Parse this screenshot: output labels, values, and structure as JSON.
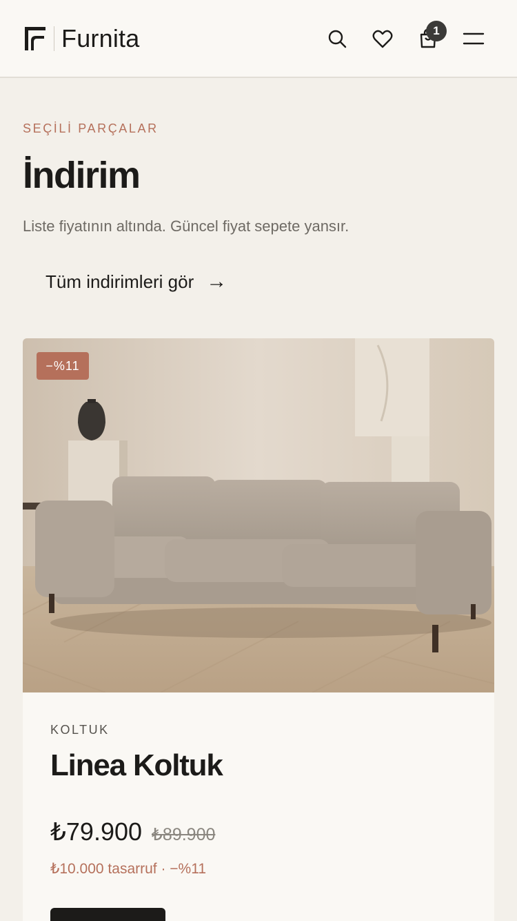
{
  "header": {
    "brand": "Furnita",
    "cart_count": "1",
    "icons": [
      "search-icon",
      "heart-icon",
      "bag-icon",
      "menu-icon"
    ]
  },
  "section": {
    "eyebrow": "SEÇİLİ PARÇALAR",
    "title": "İndirim",
    "description": "Liste fiyatının altında. Güncel fiyat sepete yansır.",
    "cta_label": "Tüm indirimleri gör",
    "cta_arrow": "→"
  },
  "product": {
    "badge": "−%11",
    "category": "KOLTUK",
    "name": "Linea Koltuk",
    "price": "₺79.900",
    "old_price": "₺89.900",
    "savings": "₺10.000 tasarruf · −%11"
  },
  "colors": {
    "accent": "#b5705b",
    "background": "#f3f0ea",
    "surface": "#faf8f4",
    "text": "#1c1b19"
  }
}
